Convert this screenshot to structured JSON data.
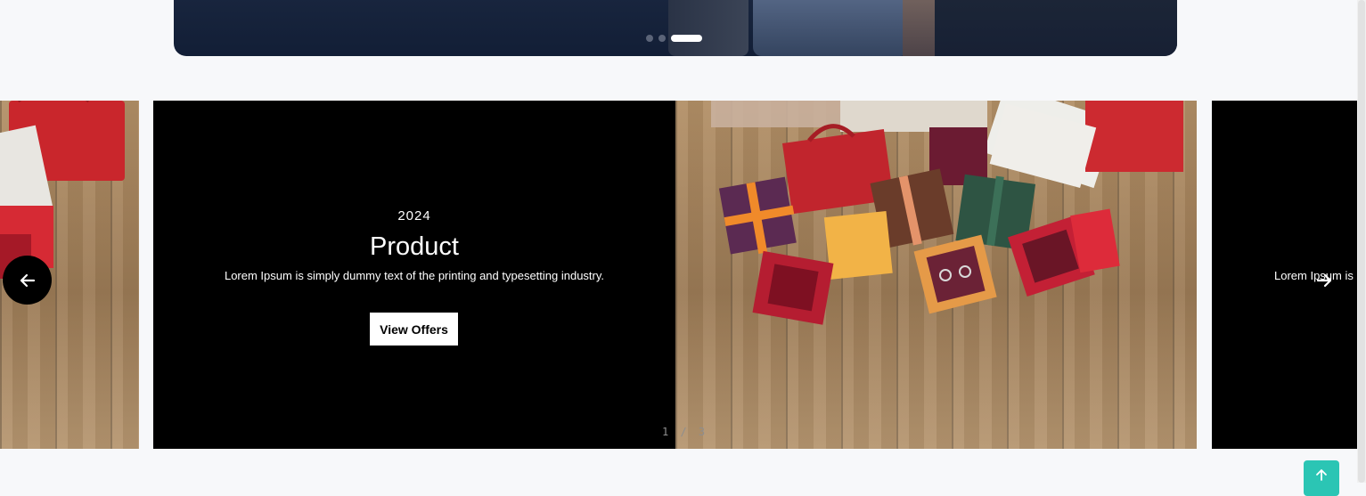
{
  "hero": {
    "dots": [
      {
        "active": false
      },
      {
        "active": false
      },
      {
        "active": true
      }
    ]
  },
  "slider": {
    "current": {
      "year": "2024",
      "title": "Product",
      "description": "Lorem Ipsum is simply dummy text of the printing and typesetting industry.",
      "button_label": "View Offers"
    },
    "next_peek_text": "Lorem Ipsum is simply dummy text of the printing and typesetting industry.",
    "counter": "1 / 3",
    "prev_icon": "arrow-left-icon",
    "next_icon": "arrow-right-icon"
  },
  "scroll_top": {
    "icon": "arrow-up-icon",
    "color": "#2bc5b4"
  },
  "colors": {
    "page_bg": "#f7f8fa",
    "slide_text_bg": "#000000",
    "hero_bg": "#142038"
  }
}
